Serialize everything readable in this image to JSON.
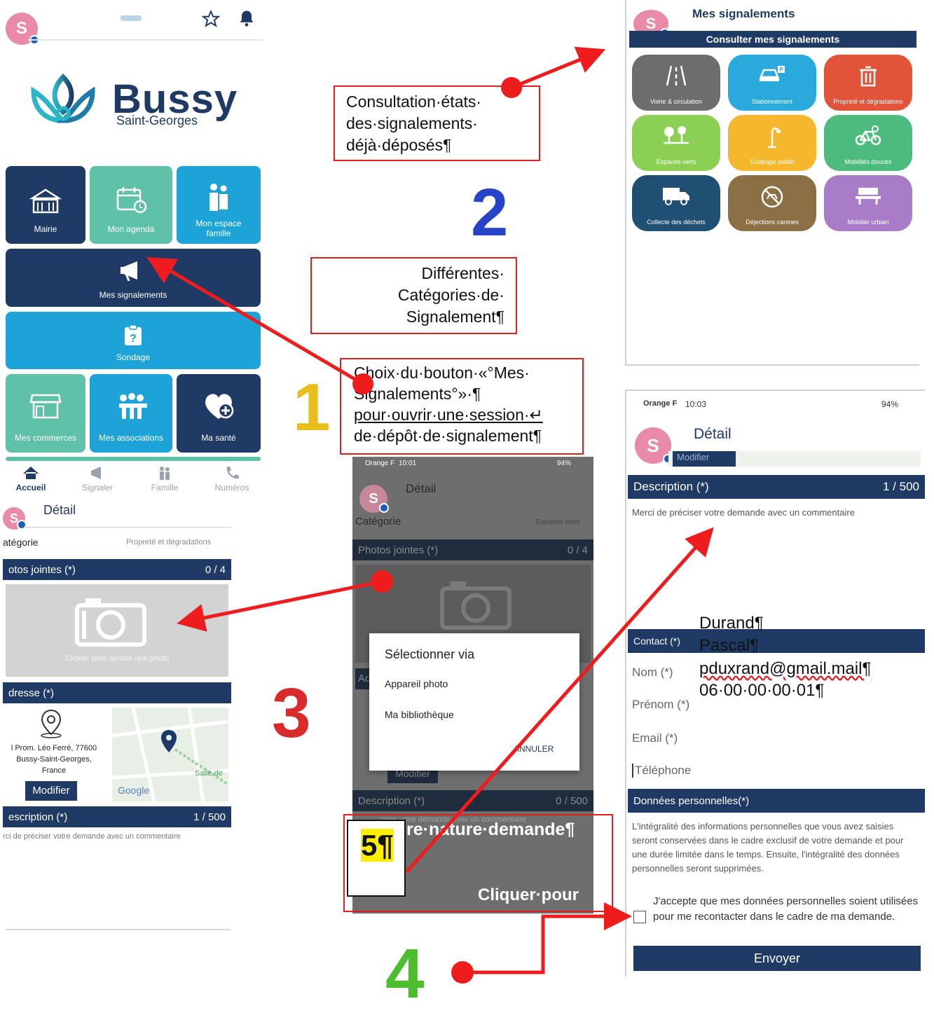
{
  "panel1": {
    "avatar_letter": "S",
    "logo_brand": "Bussy",
    "logo_sub": "Saint-Georges",
    "tiles": [
      {
        "label": "Mairie",
        "icon": "town-hall-icon"
      },
      {
        "label": "Mon agenda",
        "icon": "calendar-icon"
      },
      {
        "label": "Mon espace famille",
        "icon": "family-icon"
      },
      {
        "label": "Mes signalements",
        "icon": "megaphone-icon"
      },
      {
        "label": "Sondage",
        "icon": "survey-icon"
      },
      {
        "label": "Mes commerces",
        "icon": "shop-icon"
      },
      {
        "label": "Mes associations",
        "icon": "associations-icon"
      },
      {
        "label": "Ma santé",
        "icon": "health-icon"
      }
    ],
    "bottom_nav": [
      "Accueil",
      "Signaler",
      "Famille",
      "Numéros"
    ]
  },
  "panel2": {
    "title": "Mes signalements",
    "header_bar": "Consulter mes signalements",
    "categories": [
      {
        "label": "Voirie & circulation",
        "color": "#6d6d6d"
      },
      {
        "label": "Stationnement",
        "color": "#2aa9dc"
      },
      {
        "label": "Propreté et dégradations",
        "color": "#e2543a"
      },
      {
        "label": "Espaces verts",
        "color": "#8ccf55"
      },
      {
        "label": "Eclairage public",
        "color": "#f5b72b"
      },
      {
        "label": "Mobilités douces",
        "color": "#4dbb7e"
      },
      {
        "label": "Collecte des déchets",
        "color": "#1f4f73"
      },
      {
        "label": "Déjections canines",
        "color": "#8a7044"
      },
      {
        "label": "Mobilier urbain",
        "color": "#a97cc9"
      }
    ]
  },
  "panel3": {
    "title": "Détail",
    "category_label": "atégorie",
    "category_value": "Propreté et dégradations",
    "photos_label": "otos jointes (*)",
    "photos_count": "0 / 4",
    "photo_hint": "Cliquer pour ajouter une photo",
    "address_label": "dresse (*)",
    "address_lines": [
      "l Prom. Léo Ferré, 77600",
      "Bussy-Saint-Georges,",
      "France"
    ],
    "modify_button": "Modifier",
    "map_text": "Salle de",
    "google": "Google",
    "description_label": "escription (*)",
    "description_count": "1 / 500",
    "description_hint": "rci de préciser votre demande avec un commentaire"
  },
  "panel4": {
    "status_carrier": "Orange F",
    "status_time": "10:01",
    "status_battery": "94%",
    "title": "Détail",
    "category_label": "Catégorie",
    "category_value": "Espaces verts",
    "photos_label": "Photos jointes (*)",
    "photos_count": "0 / 4",
    "dialog_title": "Sélectionner via",
    "dialog_options": [
      "Appareil photo",
      "Ma bibliothèque"
    ],
    "dialog_cancel": "ANNULER",
    "address_stub": "Ad",
    "modify_button": "Modifier",
    "description_label": "Description (*)",
    "description_count": "0 / 500",
    "description_hint": "ciser votre demande avec un commentaire",
    "overlay_line1": "re·nature·demande¶",
    "overlay_line2": "Cliquer·pour"
  },
  "panel5": {
    "status_carrier": "Orange F",
    "status_time": "10:03",
    "status_battery": "94%",
    "title": "Détail",
    "stub_text": "Modifier",
    "description_label": "Description (*)",
    "description_count": "1 / 500",
    "description_hint": "Merci de préciser votre demande avec un commentaire",
    "contact_label": "Contact (*)",
    "nom_label": "Nom (*)",
    "prenom_label": "Prénom (*)",
    "email_label": "Email (*)",
    "telephone_label": "Téléphone",
    "overlay_values": [
      "Durand¶",
      "Pascal¶",
      "pduxrand@gmail.mail¶",
      "06·00·00·00·01¶"
    ],
    "personal_label": "Données personnelles(*)",
    "personal_text": "L'intégralité des informations personnelles que vous avez saisies seront conservées dans le cadre exclusif de votre demande et pour une durée limitée dans le temps. Ensuite, l'intégralité des données personnelles seront supprimées.",
    "consent_text": "J'accepte que mes données personnelles soient utilisées pour me recontacter dans le cadre de ma demande.",
    "send_button": "Envoyer"
  },
  "annotations": {
    "consultation": [
      "Consultation·états·",
      "des·signalements·",
      "déjà·déposés¶"
    ],
    "categories": [
      "Différentes·",
      "Catégories·de·",
      "Signalement¶"
    ],
    "choice": [
      "Choix·du·bouton·«°Mes·",
      "Signalements°»·¶",
      "pour·ouvrir·une·session·↵",
      "de·dépôt·de·signalement¶"
    ],
    "step5": "5¶"
  },
  "step_numbers": {
    "one": "1",
    "two": "2",
    "three": "3",
    "four": "4"
  },
  "colors": {
    "navy": "#1f3a64",
    "teal": "#5fc1a7",
    "cyan": "#1ea3d8",
    "arrow": "#ee1c1c"
  }
}
